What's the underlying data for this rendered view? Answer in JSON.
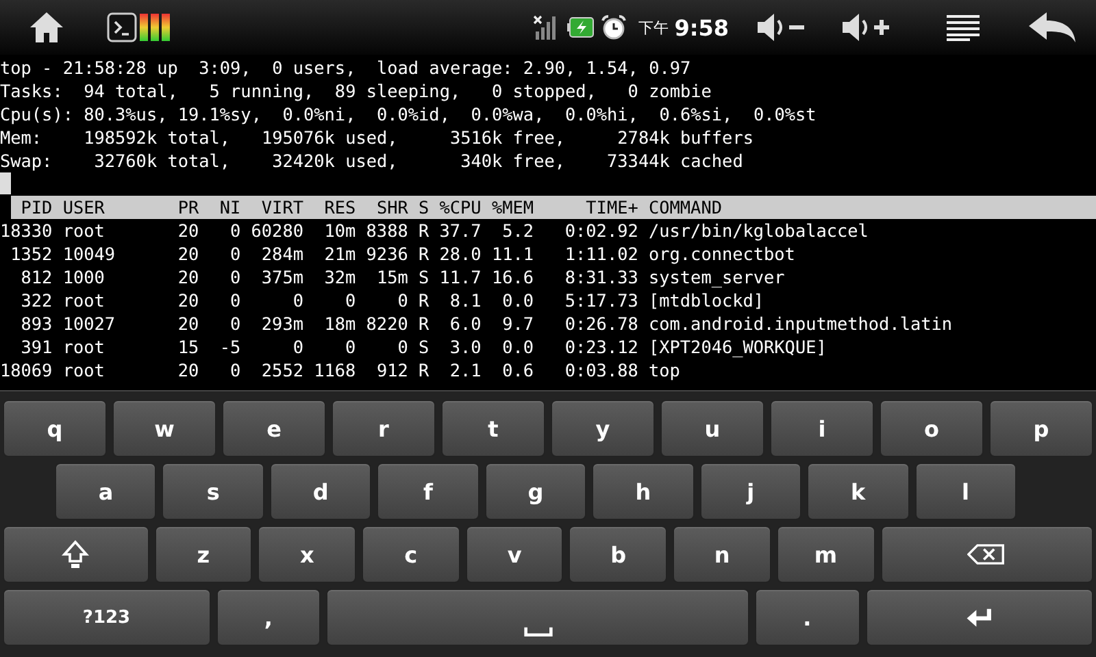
{
  "status_bar": {
    "ampm": "下午",
    "time": "9:58"
  },
  "terminal": {
    "summary_lines": [
      "top - 21:58:28 up  3:09,  0 users,  load average: 2.90, 1.54, 0.97",
      "Tasks:  94 total,   5 running,  89 sleeping,   0 stopped,   0 zombie",
      "Cpu(s): 80.3%us, 19.1%sy,  0.0%ni,  0.0%id,  0.0%wa,  0.0%hi,  0.6%si,  0.0%st",
      "Mem:    198592k total,   195076k used,     3516k free,     2784k buffers",
      "Swap:    32760k total,    32420k used,      340k free,    73344k cached"
    ],
    "table": {
      "columns": [
        "PID",
        "USER",
        "PR",
        "NI",
        "VIRT",
        "RES",
        "SHR",
        "S",
        "%CPU",
        "%MEM",
        "TIME+",
        "COMMAND"
      ],
      "rows": [
        [
          "18330",
          "root",
          "20",
          "0",
          "60280",
          "10m",
          "8388",
          "R",
          "37.7",
          "5.2",
          "0:02.92",
          "/usr/bin/kglobalaccel"
        ],
        [
          "1352",
          "10049",
          "20",
          "0",
          "284m",
          "21m",
          "9236",
          "R",
          "28.0",
          "11.1",
          "1:11.02",
          "org.connectbot"
        ],
        [
          "812",
          "1000",
          "20",
          "0",
          "375m",
          "32m",
          "15m",
          "S",
          "11.7",
          "16.6",
          "8:31.33",
          "system_server"
        ],
        [
          "322",
          "root",
          "20",
          "0",
          "0",
          "0",
          "0",
          "R",
          "8.1",
          "0.0",
          "5:17.73",
          "[mtdblockd]"
        ],
        [
          "893",
          "10027",
          "20",
          "0",
          "293m",
          "18m",
          "8220",
          "R",
          "6.0",
          "9.7",
          "0:26.78",
          "com.android.inputmethod.latin"
        ],
        [
          "391",
          "root",
          "15",
          "-5",
          "0",
          "0",
          "0",
          "S",
          "3.0",
          "0.0",
          "0:23.12",
          "[XPT2046_WORKQUE]"
        ],
        [
          "18069",
          "root",
          "20",
          "0",
          "2552",
          "1168",
          "912",
          "R",
          "2.1",
          "0.6",
          "0:03.88",
          "top"
        ]
      ]
    }
  },
  "keyboard": {
    "rows": [
      {
        "keys": [
          {
            "kind": "char",
            "label": "q"
          },
          {
            "kind": "char",
            "label": "w"
          },
          {
            "kind": "char",
            "label": "e"
          },
          {
            "kind": "char",
            "label": "r"
          },
          {
            "kind": "char",
            "label": "t"
          },
          {
            "kind": "char",
            "label": "y"
          },
          {
            "kind": "char",
            "label": "u"
          },
          {
            "kind": "char",
            "label": "i"
          },
          {
            "kind": "char",
            "label": "o"
          },
          {
            "kind": "char",
            "label": "p"
          }
        ]
      },
      {
        "keys": [
          {
            "kind": "char",
            "label": "a"
          },
          {
            "kind": "char",
            "label": "s"
          },
          {
            "kind": "char",
            "label": "d"
          },
          {
            "kind": "char",
            "label": "f"
          },
          {
            "kind": "char",
            "label": "g"
          },
          {
            "kind": "char",
            "label": "h"
          },
          {
            "kind": "char",
            "label": "j"
          },
          {
            "kind": "char",
            "label": "k"
          },
          {
            "kind": "char",
            "label": "l"
          }
        ]
      },
      {
        "keys": [
          {
            "kind": "shift"
          },
          {
            "kind": "char",
            "label": "z"
          },
          {
            "kind": "char",
            "label": "x"
          },
          {
            "kind": "char",
            "label": "c"
          },
          {
            "kind": "char",
            "label": "v"
          },
          {
            "kind": "char",
            "label": "b"
          },
          {
            "kind": "char",
            "label": "n"
          },
          {
            "kind": "char",
            "label": "m"
          },
          {
            "kind": "backspace"
          }
        ]
      },
      {
        "keys": [
          {
            "kind": "mode",
            "label": "?123"
          },
          {
            "kind": "char",
            "label": ","
          },
          {
            "kind": "space"
          },
          {
            "kind": "char",
            "label": "."
          },
          {
            "kind": "enter"
          }
        ]
      }
    ]
  }
}
